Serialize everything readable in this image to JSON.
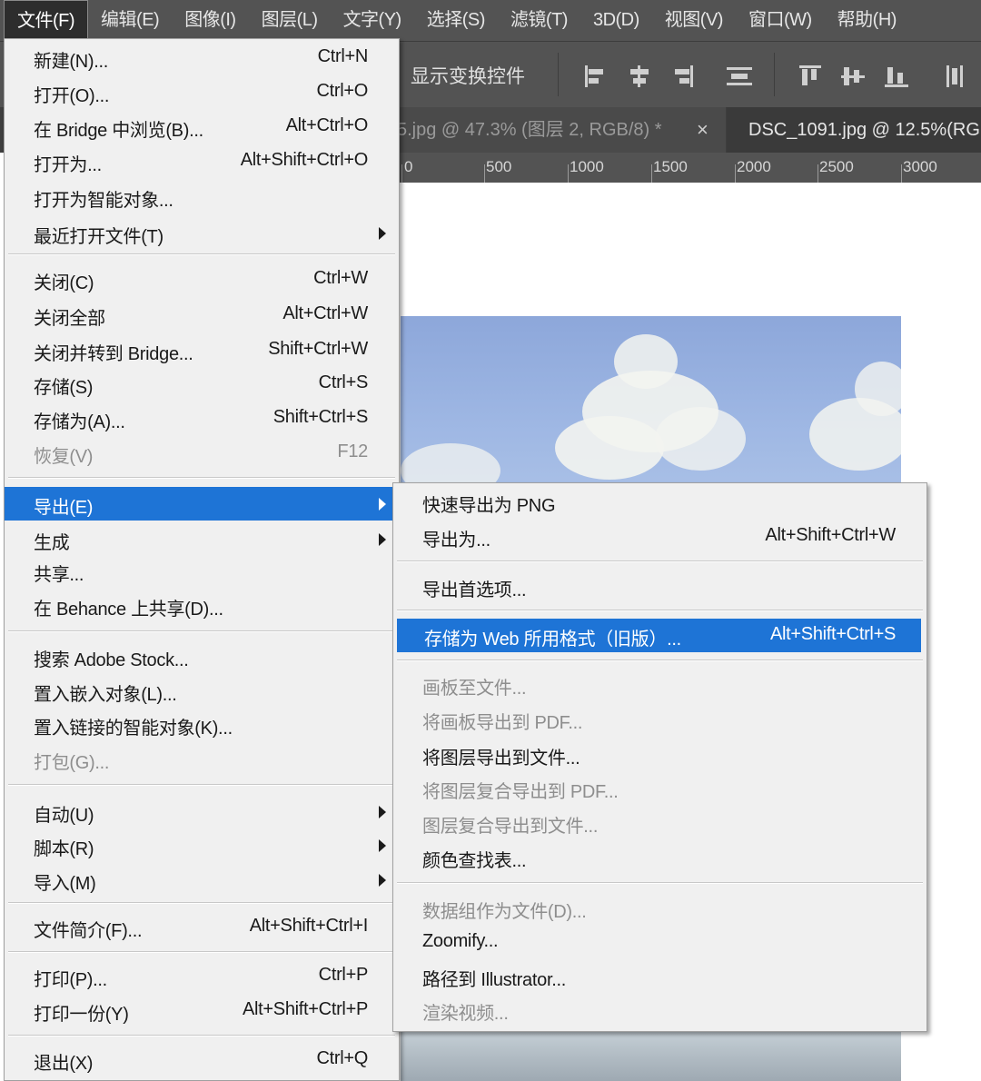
{
  "menubar": [
    "文件(F)",
    "编辑(E)",
    "图像(I)",
    "图层(L)",
    "文字(Y)",
    "选择(S)",
    "滤镜(T)",
    "3D(D)",
    "视图(V)",
    "窗口(W)",
    "帮助(H)"
  ],
  "options_bar": {
    "transform_controls_label": "显示变换控件"
  },
  "tabs": {
    "doc1": "5.jpg @ 47.3% (图层 2, RGB/8) *",
    "doc1_close": "×",
    "doc2": "DSC_1091.jpg @ 12.5%(RG"
  },
  "ruler": [
    "0",
    "500",
    "1000",
    "1500",
    "2000",
    "2500",
    "3000"
  ],
  "file_menu": {
    "new": {
      "label": "新建(N)...",
      "shortcut": "Ctrl+N"
    },
    "open": {
      "label": "打开(O)...",
      "shortcut": "Ctrl+O"
    },
    "browse_bridge": {
      "label": "在 Bridge 中浏览(B)...",
      "shortcut": "Alt+Ctrl+O"
    },
    "open_as": {
      "label": "打开为...",
      "shortcut": "Alt+Shift+Ctrl+O"
    },
    "open_smart": {
      "label": "打开为智能对象..."
    },
    "recent": {
      "label": "最近打开文件(T)"
    },
    "close": {
      "label": "关闭(C)",
      "shortcut": "Ctrl+W"
    },
    "close_all": {
      "label": "关闭全部",
      "shortcut": "Alt+Ctrl+W"
    },
    "close_bridge": {
      "label": "关闭并转到 Bridge...",
      "shortcut": "Shift+Ctrl+W"
    },
    "save": {
      "label": "存储(S)",
      "shortcut": "Ctrl+S"
    },
    "save_as": {
      "label": "存储为(A)...",
      "shortcut": "Shift+Ctrl+S"
    },
    "revert": {
      "label": "恢复(V)",
      "shortcut": "F12"
    },
    "export": {
      "label": "导出(E)"
    },
    "generate": {
      "label": "生成"
    },
    "share": {
      "label": "共享..."
    },
    "behance": {
      "label": "在 Behance 上共享(D)..."
    },
    "adobe_stock": {
      "label": "搜索 Adobe Stock..."
    },
    "place_embedded": {
      "label": "置入嵌入对象(L)..."
    },
    "place_linked": {
      "label": "置入链接的智能对象(K)..."
    },
    "package": {
      "label": "打包(G)..."
    },
    "automate": {
      "label": "自动(U)"
    },
    "scripts": {
      "label": "脚本(R)"
    },
    "import": {
      "label": "导入(M)"
    },
    "file_info": {
      "label": "文件简介(F)...",
      "shortcut": "Alt+Shift+Ctrl+I"
    },
    "print": {
      "label": "打印(P)...",
      "shortcut": "Ctrl+P"
    },
    "print_one": {
      "label": "打印一份(Y)",
      "shortcut": "Alt+Shift+Ctrl+P"
    },
    "exit": {
      "label": "退出(X)",
      "shortcut": "Ctrl+Q"
    }
  },
  "export_menu": {
    "quick_png": {
      "label": "快速导出为 PNG"
    },
    "export_as": {
      "label": "导出为...",
      "shortcut": "Alt+Shift+Ctrl+W"
    },
    "prefs": {
      "label": "导出首选项..."
    },
    "save_web": {
      "label": "存储为 Web 所用格式（旧版）...",
      "shortcut": "Alt+Shift+Ctrl+S"
    },
    "artboards_files": {
      "label": "画板至文件..."
    },
    "artboards_pdf": {
      "label": "将画板导出到 PDF..."
    },
    "layers_files": {
      "label": "将图层导出到文件..."
    },
    "comps_pdf": {
      "label": "将图层复合导出到 PDF..."
    },
    "comps_files": {
      "label": "图层复合导出到文件..."
    },
    "color_lookup": {
      "label": "颜色查找表..."
    },
    "data_sets": {
      "label": "数据组作为文件(D)..."
    },
    "zoomify": {
      "label": "Zoomify..."
    },
    "paths_ai": {
      "label": "路径到 Illustrator..."
    },
    "render_video": {
      "label": "渲染视频..."
    }
  }
}
